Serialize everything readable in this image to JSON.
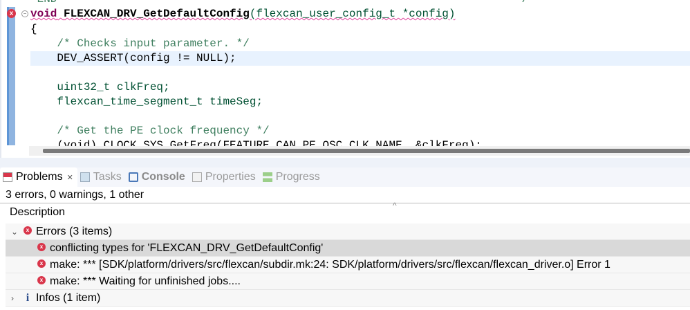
{
  "editor": {
    "lines": [
      "*END**********************************************************************/",
      "void",
      "FLEXCAN_DRV_GetDefaultConfig",
      "(flexcan_user_config_t *config)",
      "{",
      "    /* Checks input parameter. */",
      "    DEV_ASSERT(config != NULL);",
      "",
      "    uint32_t clkFreq;",
      "    flexcan_time_segment_t timeSeg;",
      "",
      "    /* Get the PE clock frequency */",
      "    (void) CLOCK_SYS_GetFreq(FEATURE_CAN_PE_OSC_CLK_NAME, &clkFreq);"
    ]
  },
  "panel": {
    "tabs": [
      {
        "label": "Problems",
        "icon": "problems-icon",
        "active": true
      },
      {
        "label": "Tasks",
        "icon": "tasks-icon"
      },
      {
        "label": "Console",
        "icon": "console-icon"
      },
      {
        "label": "Properties",
        "icon": "properties-icon"
      },
      {
        "label": "Progress",
        "icon": "progress-icon"
      }
    ],
    "close_glyph": "✕",
    "status": "3 errors, 0 warnings, 1 other",
    "column_header": "Description",
    "groups": {
      "errors": "Errors (3 items)",
      "infos": "Infos (1 item)"
    },
    "errors": [
      "conflicting types for 'FLEXCAN_DRV_GetDefaultConfig'",
      "make: *** [SDK/platform/drivers/src/flexcan/subdir.mk:24: SDK/platform/drivers/src/flexcan/flexcan_driver.o] Error 1",
      "make: *** Waiting for unfinished jobs...."
    ]
  },
  "colors": {
    "error": "#d9364b",
    "comment": "#3f7f5f",
    "keyword": "#7f0055",
    "ruler": "#8fb4e0"
  }
}
